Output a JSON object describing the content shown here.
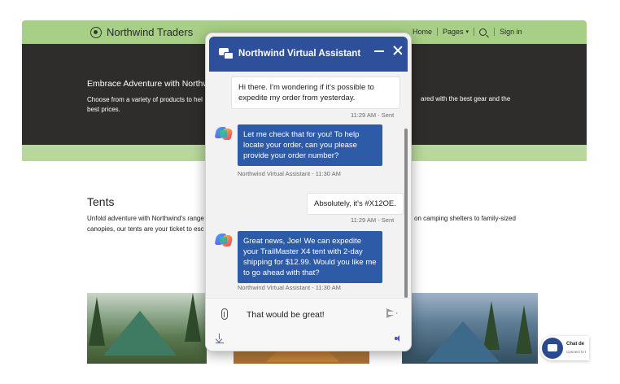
{
  "site": {
    "brand": "Northwind Traders",
    "nav": {
      "home": "Home",
      "pages": "Pages",
      "signin": "Sign in"
    },
    "hero": {
      "title": "Embrace Adventure with Northwi",
      "text_left": "Choose from a variety of products to hel",
      "text_right": "ared with the best gear and the",
      "text_line2": "best prices."
    },
    "section": {
      "title": "Tents",
      "text_left_line1": "Unfold adventure with Northwind's range",
      "text_left_line2": "canopies, our tents are your ticket to esc",
      "text_right": "on camping shelters to family-sized"
    }
  },
  "launcher": {
    "title": "Chat de",
    "subtitle": "Connect to t"
  },
  "chat": {
    "title": "Northwind Virtual Assistant",
    "messages": [
      {
        "from": "user",
        "text": "Hi there. I'm wondering if it's possible to expedite my order from yesterday.",
        "meta": "11:29 AM - Sent"
      },
      {
        "from": "bot",
        "text": "Let me check that for you! To help locate your order, can you please provide your order number?",
        "meta": "Northwind Virtual Assistant - 11:30 AM"
      },
      {
        "from": "user",
        "text": "Absolutely, it's #X12OE.",
        "meta": "11:29 AM - Sent"
      },
      {
        "from": "bot",
        "text": "Great news, Joe! We can expedite your TrailMaster X4 tent with 2-day shipping for $12.99. Would you like me to go ahead with that?",
        "meta": "Northwind Virtual Assistant - 11:30 AM"
      }
    ],
    "input_value": "That would be great!"
  },
  "colors": {
    "topbar": "#a8cf86",
    "hero": "#2e2d2b",
    "chat_header": "#2e4f9a",
    "bot_bubble": "#2e5ba8"
  },
  "icons": [
    "brand-logo-icon",
    "search-icon",
    "chat-bubbles-icon",
    "minimize-icon",
    "close-icon",
    "copilot-avatar-icon",
    "attach-icon",
    "send-icon",
    "download-icon",
    "speaker-icon"
  ]
}
